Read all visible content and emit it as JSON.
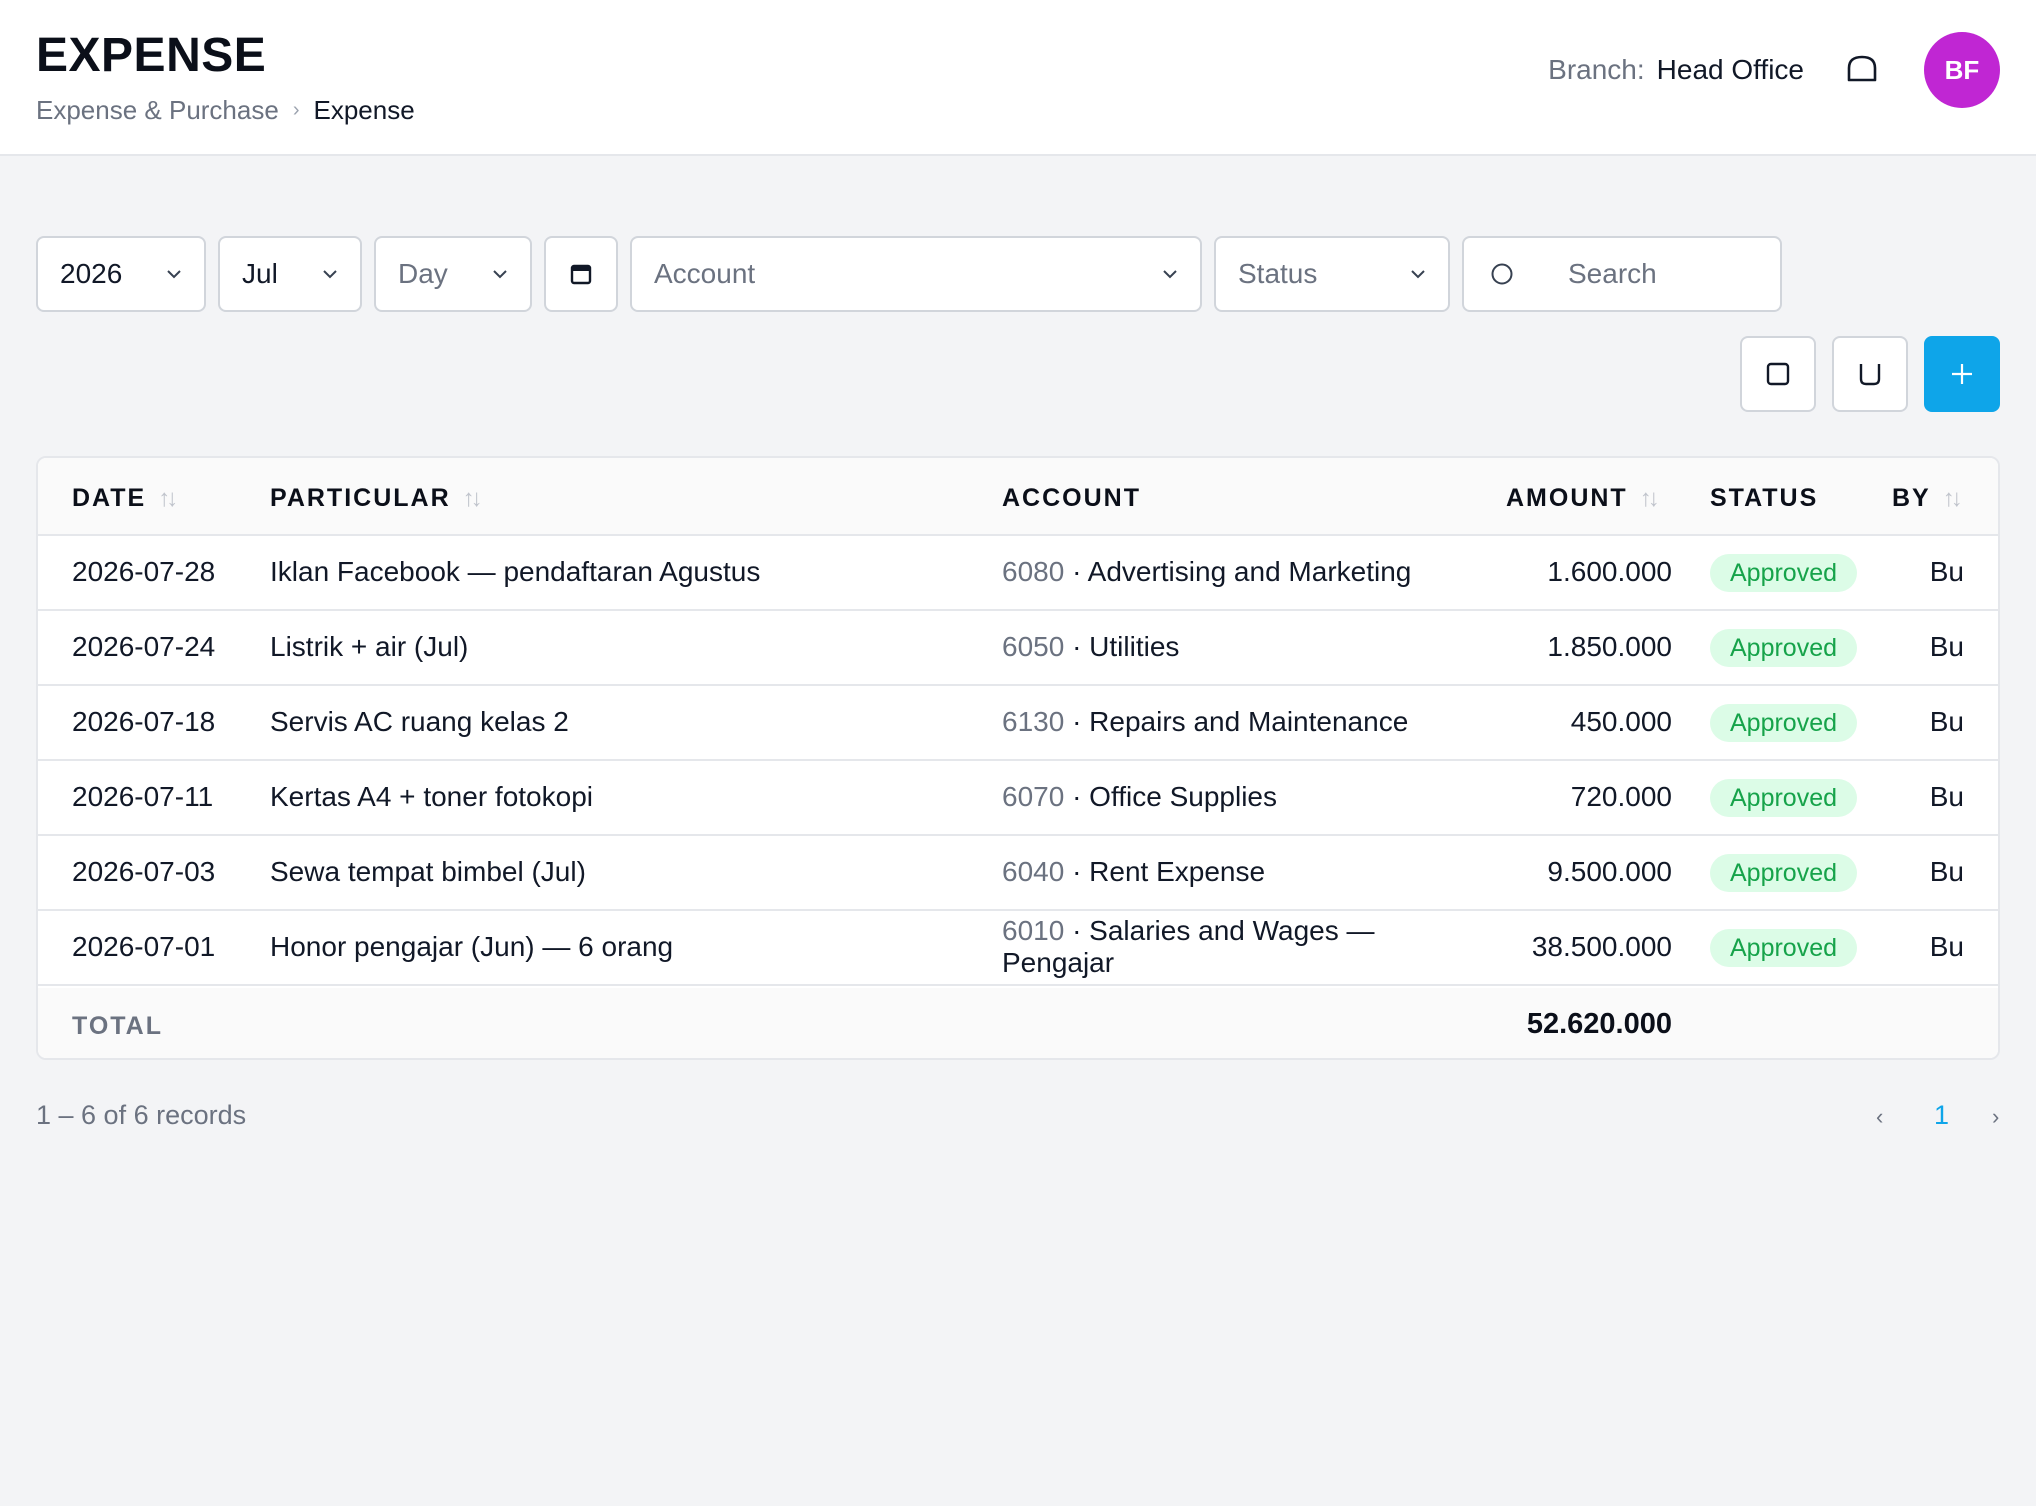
{
  "header": {
    "title": "EXPENSE",
    "breadcrumb": [
      "Expense & Purchase",
      "Expense"
    ],
    "branch_label": "Branch:",
    "branch_value": "Head Office",
    "avatar_initials": "BF",
    "avatar_color": "#c026d3"
  },
  "filters": {
    "year": "2026",
    "month": "Jul",
    "day_placeholder": "Day",
    "account_placeholder": "Account",
    "status_placeholder": "Status",
    "search_placeholder": "Search"
  },
  "actions": {
    "accent": "#0ea5e9",
    "buttons": [
      "square-icon",
      "tray-icon",
      "plus-icon"
    ]
  },
  "table": {
    "headers": {
      "date": "DATE",
      "particular": "PARTICULAR",
      "account": "ACCOUNT",
      "amount": "AMOUNT",
      "status": "STATUS",
      "by": "BY"
    },
    "rows": [
      {
        "date": "2026-07-28",
        "particular": "Iklan Facebook — pendaftaran Agustus",
        "code": "6080",
        "account": "· Advertising and Marketing",
        "amount": "1.600.000",
        "status": "Approved",
        "by": "Bu"
      },
      {
        "date": "2026-07-24",
        "particular": "Listrik + air (Jul)",
        "code": "6050",
        "account": "· Utilities",
        "amount": "1.850.000",
        "status": "Approved",
        "by": "Bu"
      },
      {
        "date": "2026-07-18",
        "particular": "Servis AC ruang kelas 2",
        "code": "6130",
        "account": "· Repairs and Maintenance",
        "amount": "450.000",
        "status": "Approved",
        "by": "Bu"
      },
      {
        "date": "2026-07-11",
        "particular": "Kertas A4 + toner fotokopi",
        "code": "6070",
        "account": "· Office Supplies",
        "amount": "720.000",
        "status": "Approved",
        "by": "Bu"
      },
      {
        "date": "2026-07-03",
        "particular": "Sewa tempat bimbel (Jul)",
        "code": "6040",
        "account": "· Rent Expense",
        "amount": "9.500.000",
        "status": "Approved",
        "by": "Bu"
      },
      {
        "date": "2026-07-01",
        "particular": "Honor pengajar (Jun) — 6 orang",
        "code": "6010",
        "account": "· Salaries and Wages — Pengajar",
        "amount": "38.500.000",
        "status": "Approved",
        "by": "Bu"
      }
    ],
    "total_label": "TOTAL",
    "total_amount": "52.620.000"
  },
  "footer": {
    "records": "1 – 6 of 6 records",
    "prev": "‹",
    "page": "1",
    "next": "›"
  }
}
